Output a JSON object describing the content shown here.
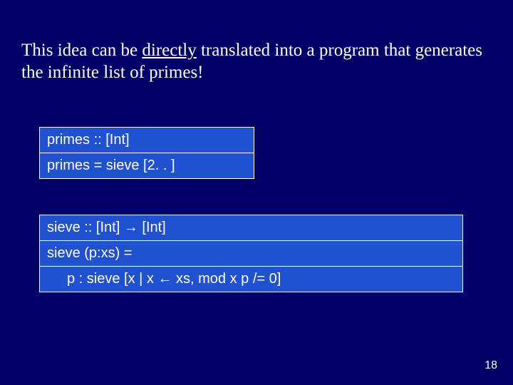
{
  "heading": {
    "pre": "This idea can be ",
    "underlined": "directly",
    "post": " translated into a program that generates the infinite list of primes!"
  },
  "code_block_1": {
    "line1": "primes :: [Int]",
    "line2": "primes = sieve [2. . ]"
  },
  "code_block_2": {
    "line1_pre": "sieve :: [Int] ",
    "line1_post": " [Int]",
    "line2": "sieve (p:xs) =",
    "line3_pre": "p : sieve [x | x ",
    "line3_post": " xs, mod x p /= 0]"
  },
  "icons": {
    "arrow_right": "arrow-right-icon",
    "arrow_left": "arrow-left-icon"
  },
  "page_number": "18"
}
